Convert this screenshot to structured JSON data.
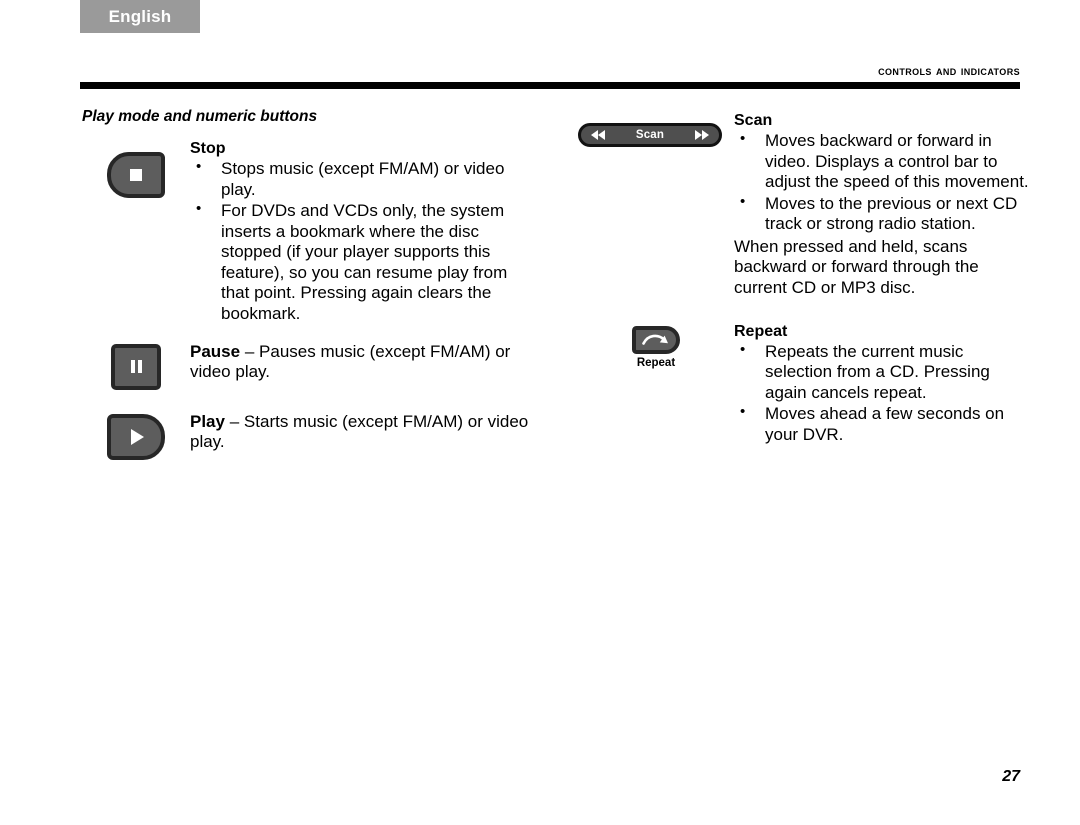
{
  "page": {
    "language_tab": "English",
    "running_head": "Controls and Indicators",
    "section_title": "Play mode and numeric buttons",
    "page_number": "27"
  },
  "colors": {
    "tab_background": "#9a9a9a",
    "tab_text": "#ffffff",
    "rule": "#000000",
    "button_face": "#5d5d5d",
    "button_border": "#272727",
    "scan_face": "#4f4f4f",
    "glyph": "#ffffff",
    "page_background": "#ffffff",
    "body_text": "#000000"
  },
  "left_column": {
    "entries": [
      {
        "icon": "stop-button-icon",
        "term": "Stop",
        "bullets": [
          "Stops music (except FM/AM) or video play.",
          "For DVDs and VCDs only, the system inserts a bookmark where the disc stopped (if your player supports this feature), so you can resume play from that point. Pressing again clears the bookmark."
        ]
      },
      {
        "icon": "pause-button-icon",
        "term": "Pause",
        "dash": "–",
        "description": "Pauses music (except FM/AM) or video play."
      },
      {
        "icon": "play-button-icon",
        "term": "Play",
        "dash": "–",
        "description": "Starts music (except FM/AM) or video play."
      }
    ]
  },
  "right_column": {
    "entries": [
      {
        "icon": "scan-button-icon",
        "scan_label": "Scan",
        "term": "Scan",
        "bullets": [
          "Moves backward or forward in video. Displays a control bar to adjust the speed of this movement.",
          "Moves to the previous or next CD track or strong radio station."
        ],
        "note": "When pressed and held, scans backward or forward through the current CD or MP3 disc."
      },
      {
        "icon": "repeat-button-icon",
        "icon_caption": "Repeat",
        "term": "Repeat",
        "bullets": [
          "Repeats the current music selection from a CD. Pressing again cancels repeat.",
          "Moves ahead a few seconds on your DVR."
        ]
      }
    ]
  }
}
